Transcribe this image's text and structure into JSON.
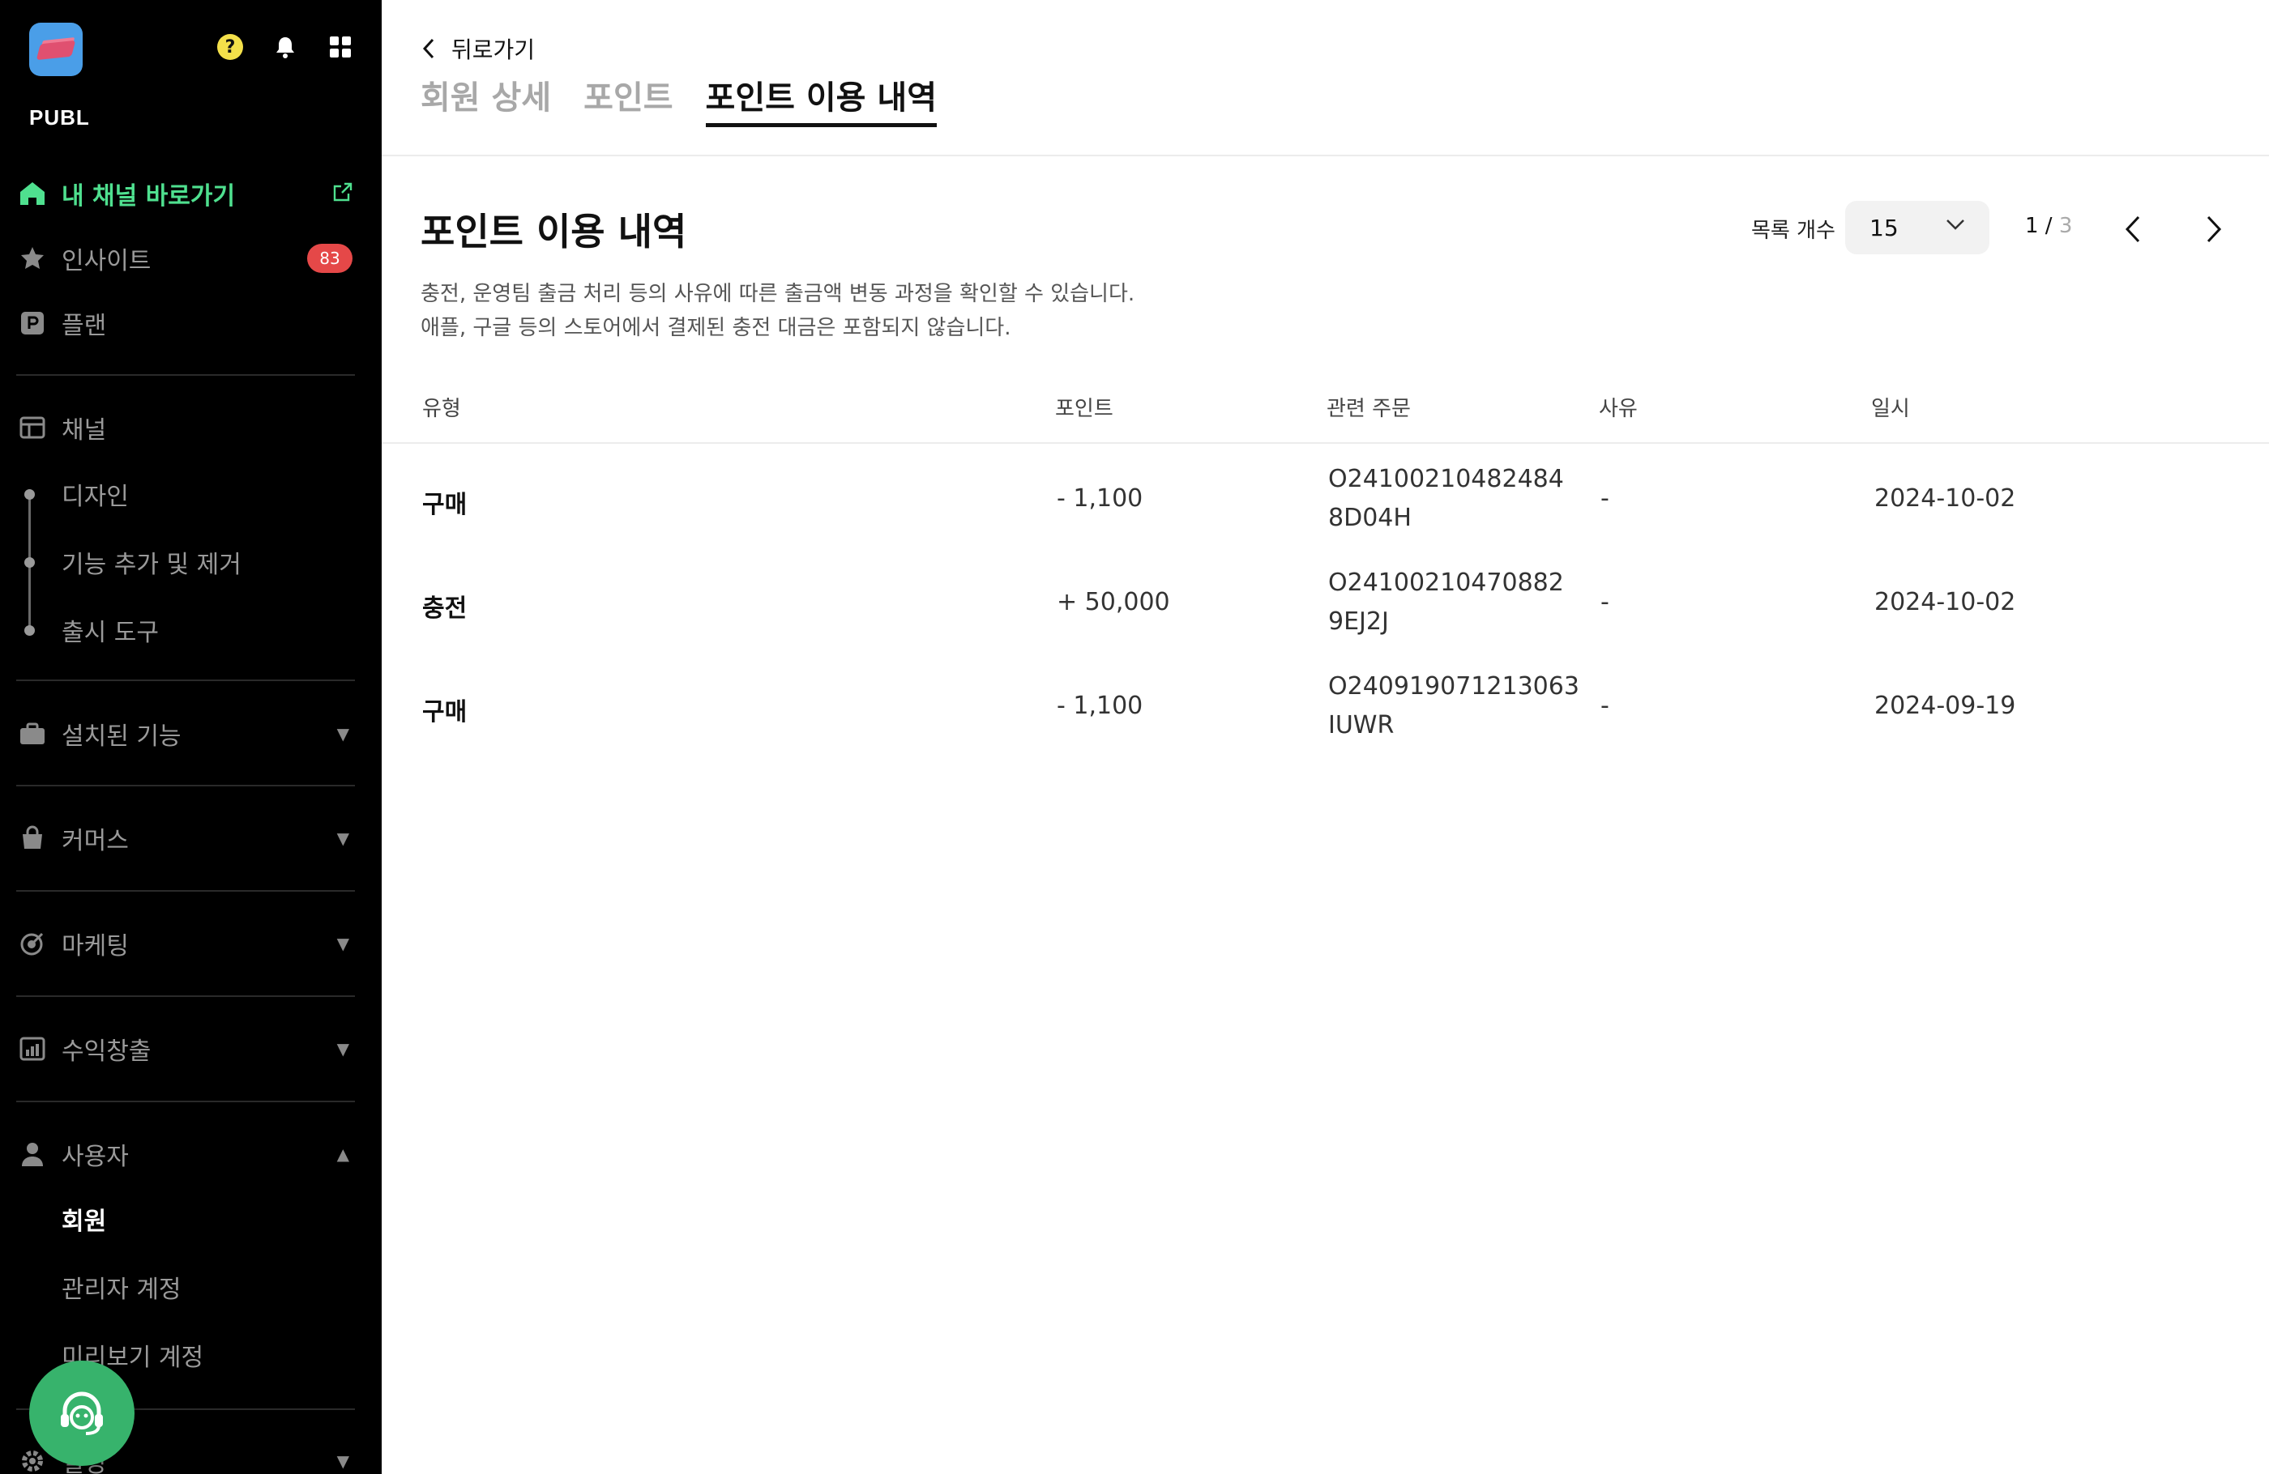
{
  "sidebar": {
    "app_name": "PUBL",
    "help_glyph": "?",
    "nav": {
      "home": "내 채널 바로가기",
      "insight": "인사이트",
      "insight_badge": "83",
      "plan": "플랜",
      "channel": "채널",
      "design": "디자인",
      "feature_edit": "기능 추가 및 제거",
      "launch_tool": "출시 도구",
      "installed": "설치된 기능",
      "commerce": "커머스",
      "marketing": "마케팅",
      "revenue": "수익창출",
      "users": "사용자",
      "members": "회원",
      "admin_accounts": "관리자 계정",
      "preview_accounts": "미리보기 계정",
      "settings": "설정"
    }
  },
  "main": {
    "back_label": "뒤로가기",
    "tabs": [
      "회원 상세",
      "포인트",
      "포인트 이용 내역"
    ],
    "section_title": "포인트 이용 내역",
    "desc_line1": "충전, 운영팀 출금 처리 등의 사유에 따른 출금액 변동 과정을 확인할 수 있습니다.",
    "desc_line2": "애플, 구글 등의 스토어에서 결제된 충전 대금은 포함되지 않습니다.",
    "list_count_label": "목록 개수",
    "list_count_value": "15",
    "pager_current": "1 /",
    "pager_total": "3",
    "columns": [
      "유형",
      "포인트",
      "관련 주문",
      "사유",
      "일시"
    ],
    "rows": [
      {
        "type": "구매",
        "points": "- 1,100",
        "order_l1": "O24100210482484",
        "order_l2": "8D04H",
        "reason": "-",
        "date": "2024-10-02"
      },
      {
        "type": "충전",
        "points": "+ 50,000",
        "order_l1": "O24100210470882",
        "order_l2": "9EJ2J",
        "reason": "-",
        "date": "2024-10-02"
      },
      {
        "type": "구매",
        "points": "- 1,100",
        "order_l1": "O240919071213063",
        "order_l2": "IUWR",
        "reason": "-",
        "date": "2024-09-19"
      }
    ]
  },
  "colors": {
    "sidebar_bg": "#000000",
    "highlight_green": "#4fe08f",
    "badge_red": "#e54848",
    "support_green": "#37b36c"
  }
}
